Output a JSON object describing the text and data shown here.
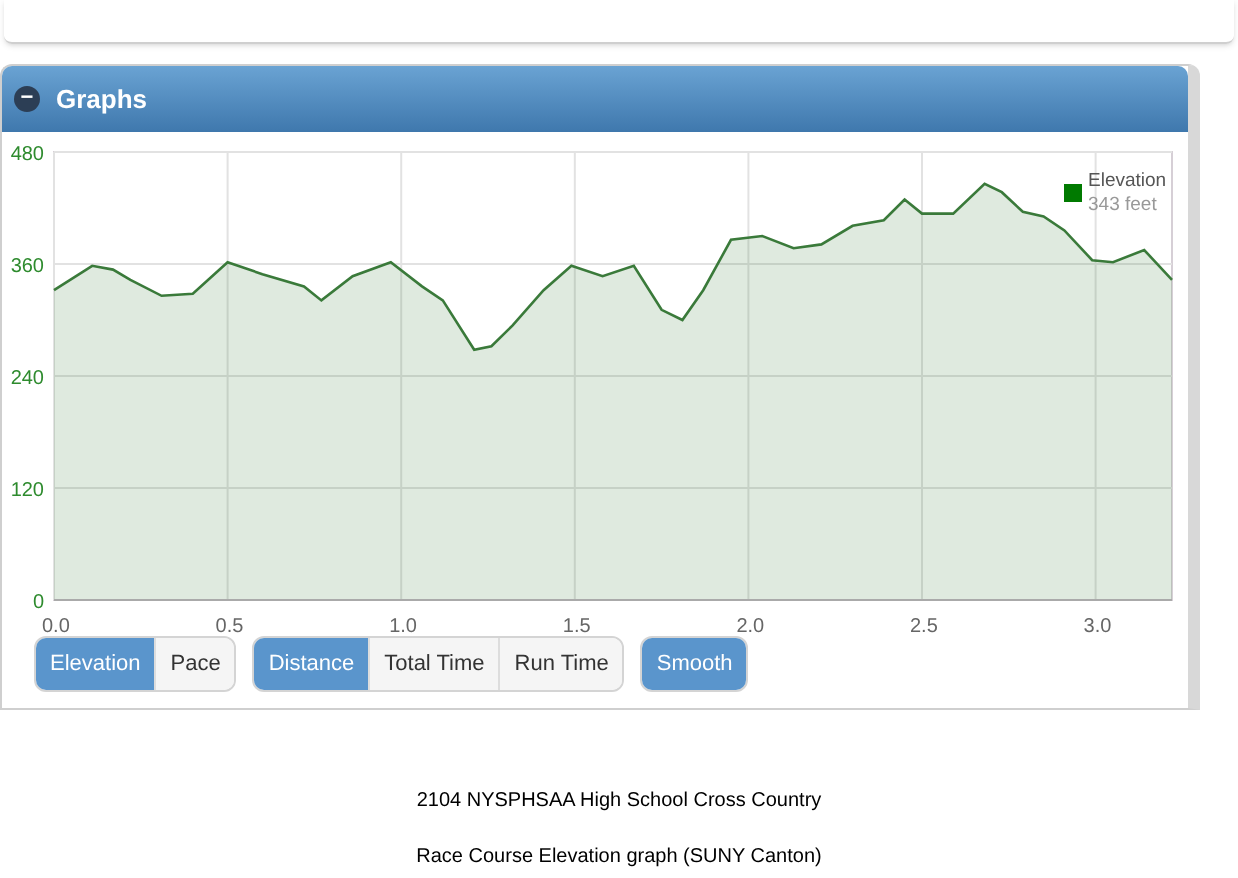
{
  "panel": {
    "title": "Graphs",
    "collapse_icon": "−"
  },
  "chart": {
    "chart_data": {
      "type": "area",
      "x": [
        0,
        0.11,
        0.17,
        0.22,
        0.31,
        0.4,
        0.5,
        0.6,
        0.72,
        0.77,
        0.86,
        0.97,
        1.06,
        1.12,
        1.21,
        1.26,
        1.32,
        1.41,
        1.49,
        1.58,
        1.67,
        1.75,
        1.81,
        1.87,
        1.95,
        2.04,
        2.13,
        2.21,
        2.3,
        2.39,
        2.45,
        2.5,
        2.59,
        2.68,
        2.73,
        2.79,
        2.85,
        2.91,
        2.99,
        3.05,
        3.14,
        3.22
      ],
      "grid": true,
      "series": [
        {
          "name": "Elevation",
          "color": "#3a7a3a",
          "values": [
            332,
            358,
            354,
            343,
            326,
            328,
            362,
            349,
            336,
            321,
            347,
            362,
            336,
            321,
            268,
            272,
            294,
            332,
            358,
            347,
            358,
            311,
            300,
            332,
            386,
            390,
            377,
            381,
            401,
            407,
            429,
            414,
            414,
            446,
            437,
            416,
            411,
            396,
            364,
            362,
            375,
            343
          ]
        }
      ],
      "xlim": [
        0,
        3.22
      ],
      "ylim": [
        0,
        480
      ],
      "xticks": [
        {
          "value": 0,
          "label": "0.0"
        },
        {
          "value": 0.5,
          "label": "0.5"
        },
        {
          "value": 1,
          "label": "1.0"
        },
        {
          "value": 1.5,
          "label": "1.5"
        },
        {
          "value": 2,
          "label": "2.0"
        },
        {
          "value": 2.5,
          "label": "2.5"
        },
        {
          "value": 3,
          "label": "3.0"
        }
      ],
      "yticks": [
        0,
        120,
        240,
        360,
        480
      ]
    },
    "legend": {
      "reading": "343 feet",
      "color": "#007a00"
    }
  },
  "button_groups": [
    [
      {
        "label": "Elevation",
        "selected": true
      },
      {
        "label": "Pace",
        "selected": false
      }
    ],
    [
      {
        "label": "Distance",
        "selected": true
      },
      {
        "label": "Total Time",
        "selected": false
      },
      {
        "label": "Run Time",
        "selected": false
      }
    ],
    [
      {
        "label": "Smooth",
        "selected": true
      }
    ]
  ],
  "caption": [
    "2104 NYSPHSAA High School Cross Country",
    "Race Course Elevation graph (SUNY Canton)"
  ]
}
